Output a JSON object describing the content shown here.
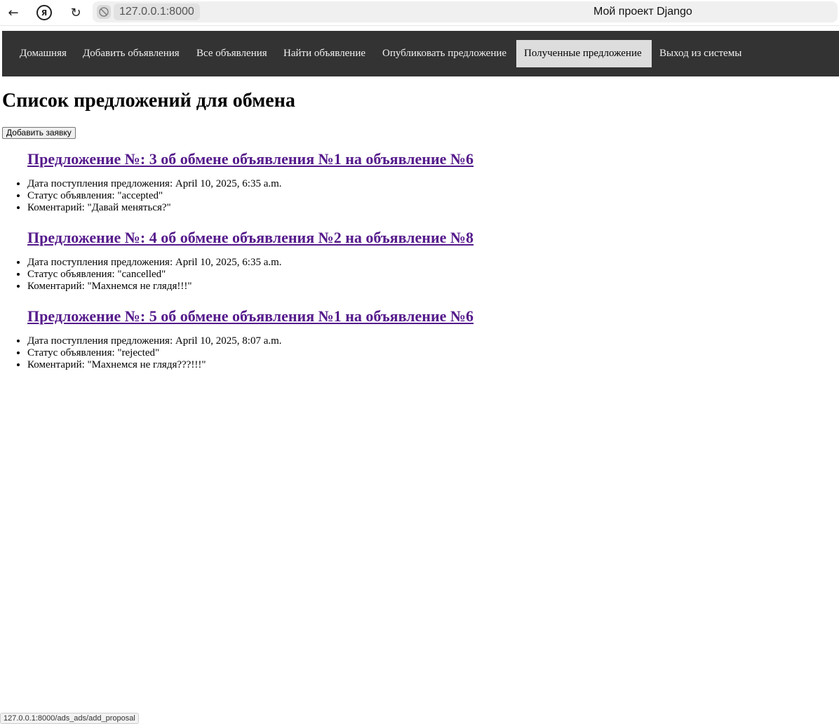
{
  "browser": {
    "url": "127.0.0.1:8000",
    "tab_title": "Мой проект Django",
    "status_url": "127.0.0.1:8000/ads_ads/add_proposal"
  },
  "nav": {
    "items": [
      {
        "label": "Домашняя"
      },
      {
        "label": "Добавить объявления"
      },
      {
        "label": "Все объявления"
      },
      {
        "label": "Найти объявление"
      },
      {
        "label": "Опубликовать предложение"
      },
      {
        "label": "Полученные предложение",
        "active": true
      },
      {
        "label": "Выход из системы"
      }
    ]
  },
  "page": {
    "heading": "Список предложений для обмена",
    "add_button": "Добавить заявку"
  },
  "proposals": [
    {
      "title": "Предложение №: 3 об обмене объявления №1 на объявление №6",
      "date": "Дата поступления предложения: April 10, 2025, 6:35 a.m.",
      "status": "Статус объявления: \"accepted\"",
      "comment": "Коментарий: \"Давай меняться?\""
    },
    {
      "title": "Предложение №: 4 об обмене объявления №2 на объявление №8",
      "date": "Дата поступления предложения: April 10, 2025, 6:35 a.m.",
      "status": "Статус объявления: \"cancelled\"",
      "comment": "Коментарий: \"Махнемся не глядя!!!\""
    },
    {
      "title": "Предложение №: 5 об обмене объявления №1 на объявление №6",
      "date": "Дата поступления предложения: April 10, 2025, 8:07 a.m.",
      "status": "Статус объявления: \"rejected\"",
      "comment": "Коментарий: \"Махнемся не глядя???!!!\""
    }
  ],
  "colors": {
    "nav_bg": "#333333",
    "nav_active_bg": "#dddddd",
    "link_visited": "#551a8b"
  }
}
